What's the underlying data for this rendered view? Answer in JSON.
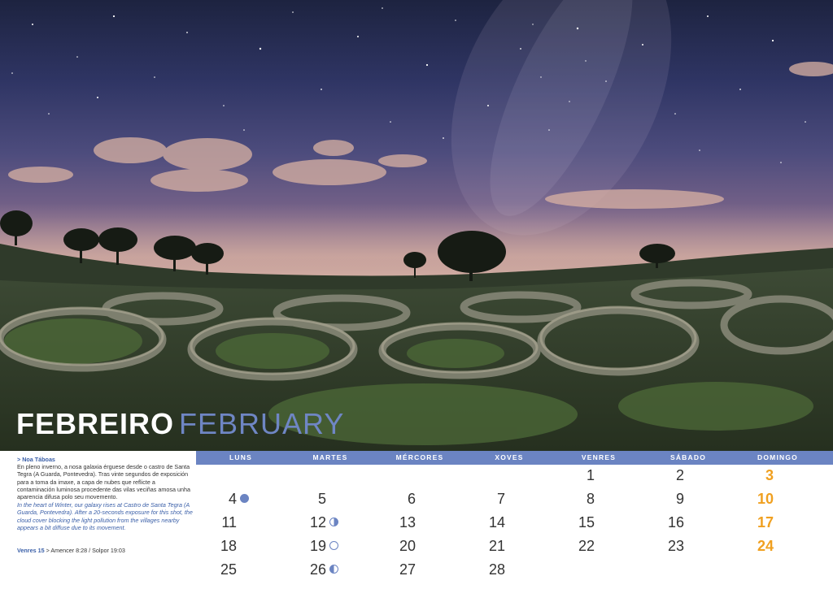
{
  "title": {
    "gl": "FEBREIRO",
    "en": "FEBRUARY"
  },
  "caption": {
    "title": "> Noa Táboas",
    "text_gl": "En pleno inverno, a nosa galaxia érguese desde o castro de Santa Tegra (A Guarda, Pontevedra). Tras vinte segundos de exposición para a toma da imaxe, a capa de nubes que reflicte a contaminación luminosa procedente das vilas veciñas amosa unha aparencia difusa polo seu movemento.",
    "text_en": "In the heart of Winter, our galaxy rises at Castro de Santa Tegra (A Guarda, Pontevedra). After a 20-seconds exposure for this shot, the cloud cover blocking the light pollution from the villages nearby appears a bit diffuse due to its movement."
  },
  "sun": {
    "day": "Venres 15",
    "times": " > Amencer 8:28 / Solpor 19:03"
  },
  "weekdays": [
    "LUNS",
    "MARTES",
    "MÉRCORES",
    "XOVES",
    "VENRES",
    "SÁBADO",
    "DOMINGO"
  ],
  "weeks": [
    [
      null,
      null,
      null,
      null,
      1,
      2,
      3
    ],
    [
      4,
      5,
      6,
      7,
      8,
      9,
      10
    ],
    [
      11,
      12,
      13,
      14,
      15,
      16,
      17
    ],
    [
      18,
      19,
      20,
      21,
      22,
      23,
      24
    ],
    [
      25,
      26,
      27,
      28,
      null,
      null,
      null
    ]
  ],
  "moon_phases": {
    "4": "new",
    "12": "first",
    "19": "full",
    "26": "last"
  },
  "colors": {
    "accent": "#6b84c2",
    "sunday": "#f0a020",
    "text": "#333333"
  },
  "photo": {
    "subject": "starry-night-over-castro-ruins"
  }
}
